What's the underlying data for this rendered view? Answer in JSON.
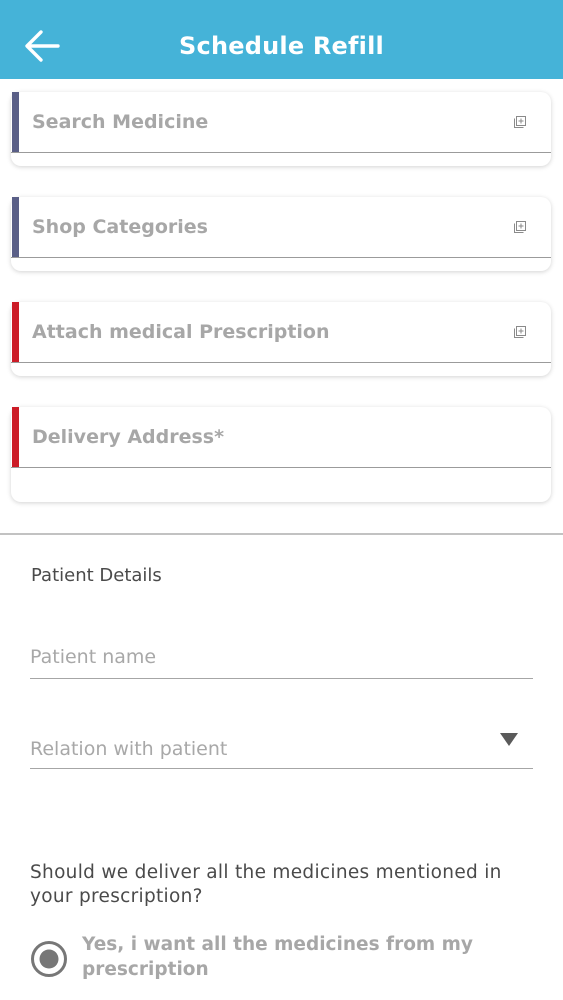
{
  "header": {
    "title": "Schedule Refill",
    "back_icon": "arrow-left-icon",
    "background": "#45b3d8"
  },
  "cards": [
    {
      "label": "Search Medicine",
      "accent": "#5a5f87",
      "icon": "add-box-icon"
    },
    {
      "label": "Shop Categories",
      "accent": "#5a5f87",
      "icon": "add-box-icon"
    },
    {
      "label": "Attach medical Prescription",
      "accent": "#cc1c27",
      "icon": "add-box-icon"
    },
    {
      "label": "Delivery Address*",
      "accent": "#cc1c27"
    }
  ],
  "patient": {
    "section_title": "Patient Details",
    "name_placeholder": "Patient name",
    "relation_label": "Relation with patient",
    "relation_icon": "triangle-down-icon"
  },
  "delivery": {
    "question": "Should we deliver all the medicines mentioned in your prescription?",
    "option_label": "Yes, i want all the medicines from my prescription",
    "option_selected": true
  }
}
